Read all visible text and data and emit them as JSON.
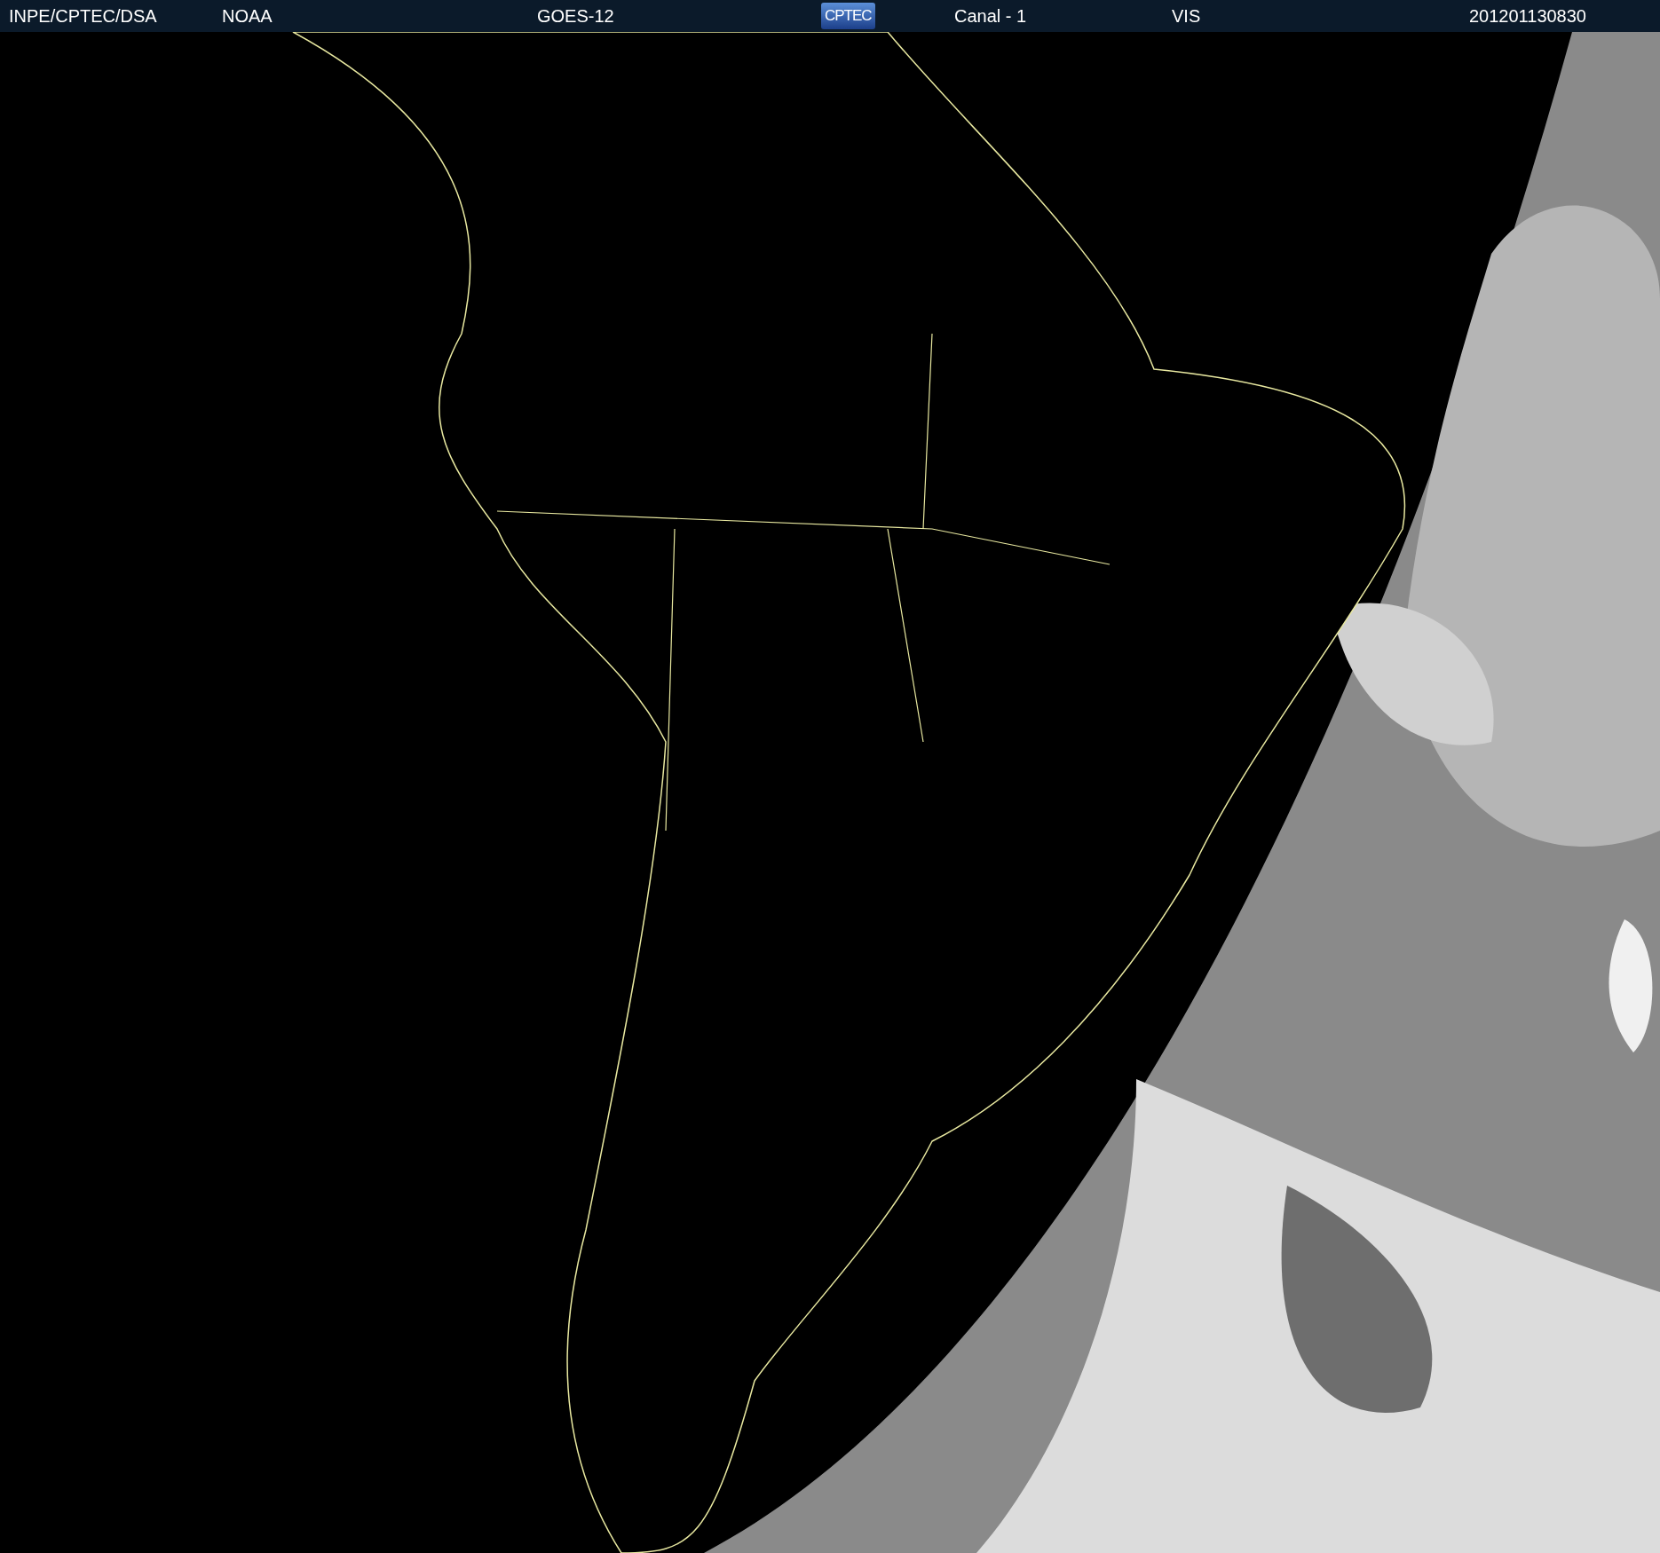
{
  "header": {
    "items": [
      {
        "kind": "text",
        "text": "INPE/CPTEC/DSA"
      },
      {
        "kind": "text",
        "text": "NOAA"
      },
      {
        "kind": "text",
        "text": "GOES-12"
      },
      {
        "kind": "logo",
        "text": "CPTEC"
      },
      {
        "kind": "text",
        "text": "Canal - 1"
      },
      {
        "kind": "text",
        "text": "VIS"
      },
      {
        "kind": "text",
        "text": "201201130830"
      }
    ]
  }
}
